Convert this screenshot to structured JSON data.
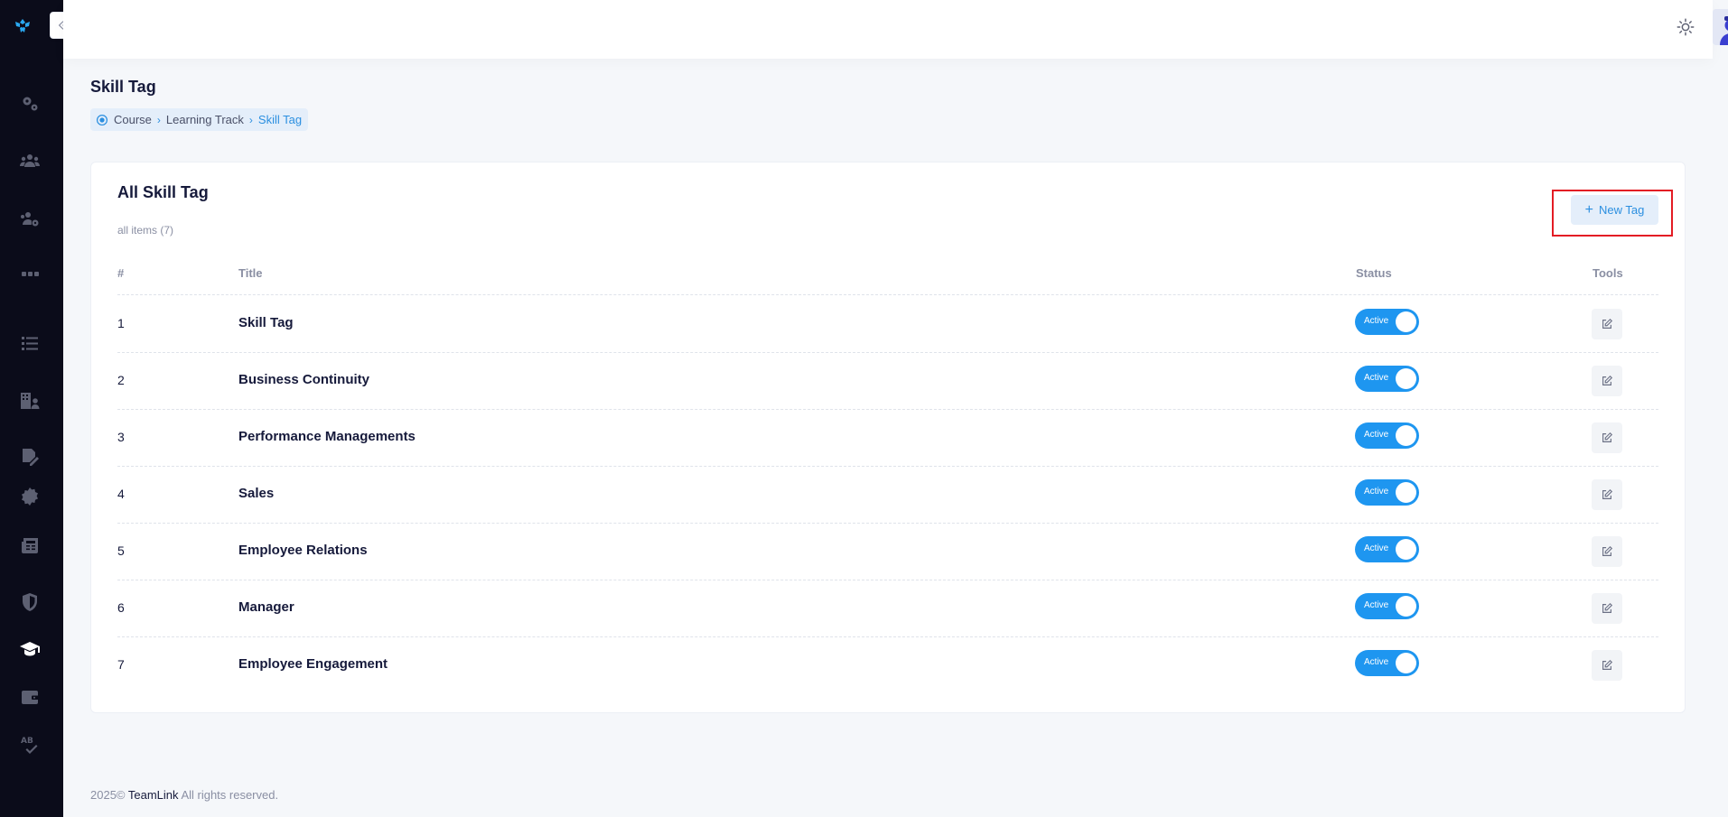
{
  "header": {
    "collapse_icon": "double-chevron-left-icon",
    "theme_icon": "sun-icon",
    "avatar": "user-avatar"
  },
  "sidebar": {
    "logo": "teamlink-logo",
    "items": [
      {
        "icon": "gears-icon",
        "active": false
      },
      {
        "icon": "users-icon",
        "active": false
      },
      {
        "icon": "users-settings-icon",
        "active": false
      },
      {
        "icon": "grid-icon",
        "active": false
      },
      {
        "icon": "list-icon",
        "active": false
      },
      {
        "icon": "building-user-icon",
        "active": false
      },
      {
        "icon": "signature-icon",
        "active": false
      },
      {
        "icon": "certificate-icon",
        "active": false
      },
      {
        "icon": "newspaper-icon",
        "active": false
      },
      {
        "icon": "shield-icon",
        "active": false
      },
      {
        "icon": "graduation-cap-icon",
        "active": true
      },
      {
        "icon": "wallet-icon",
        "active": false
      },
      {
        "icon": "spell-check-icon",
        "active": false
      }
    ]
  },
  "page": {
    "title": "Skill Tag",
    "breadcrumb": [
      "Course",
      "Learning Track",
      "Skill Tag"
    ]
  },
  "card": {
    "title": "All Skill Tag",
    "subtitle": "all items (7)",
    "new_button": "New Tag"
  },
  "table": {
    "headers": [
      "#",
      "Title",
      "Status",
      "Tools"
    ],
    "rows": [
      {
        "num": "1",
        "title": "Skill Tag",
        "status": "Active"
      },
      {
        "num": "2",
        "title": "Business Continuity",
        "status": "Active"
      },
      {
        "num": "3",
        "title": "Performance Managements",
        "status": "Active"
      },
      {
        "num": "4",
        "title": "Sales",
        "status": "Active"
      },
      {
        "num": "5",
        "title": "Employee Relations",
        "status": "Active"
      },
      {
        "num": "6",
        "title": "Manager",
        "status": "Active"
      },
      {
        "num": "7",
        "title": "Employee Engagement",
        "status": "Active"
      }
    ]
  },
  "footer": {
    "year": "2025©",
    "brand": "TeamLink",
    "rights": "All rights reserved."
  },
  "colors": {
    "accent": "#1e96f0",
    "sidebar_bg": "#0b0c1a",
    "highlight": "#e31c24"
  }
}
